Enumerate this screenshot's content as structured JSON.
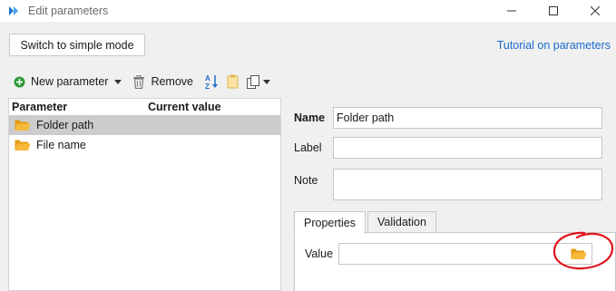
{
  "window": {
    "title": "Edit parameters",
    "controls": [
      "minimize-icon",
      "maximize-icon",
      "close-icon"
    ]
  },
  "topbar": {
    "simple_mode_button": "Switch to simple mode",
    "tutorial_link": "Tutorial on parameters"
  },
  "toolbar": {
    "new_parameter": "New parameter",
    "remove": "Remove",
    "icons": [
      "add-circle-icon",
      "caret-down-icon",
      "trash-icon",
      "sort-icon",
      "clipboard-icon",
      "copy-icon"
    ]
  },
  "tree": {
    "headers": {
      "parameter": "Parameter",
      "current_value": "Current value"
    },
    "rows": [
      {
        "name": "Folder path",
        "value": "",
        "selected": true,
        "icon": "folder-icon"
      },
      {
        "name": "File name",
        "value": "",
        "selected": false,
        "icon": "folder-icon"
      }
    ]
  },
  "form": {
    "name_label": "Name",
    "name_value": "Folder path",
    "label_label": "Label",
    "label_value": "",
    "note_label": "Note",
    "note_value": ""
  },
  "tabs": {
    "items": [
      "Properties",
      "Validation"
    ],
    "active": "Properties"
  },
  "properties": {
    "value_label": "Value",
    "value": "",
    "browse_icon": "folder-open-icon"
  },
  "colors": {
    "link": "#1b6ac9",
    "selected_row": "#cccccc",
    "folder": "#f2a81d",
    "new_param_icon": "#2e9b3a",
    "annotation": "#e0141b"
  }
}
